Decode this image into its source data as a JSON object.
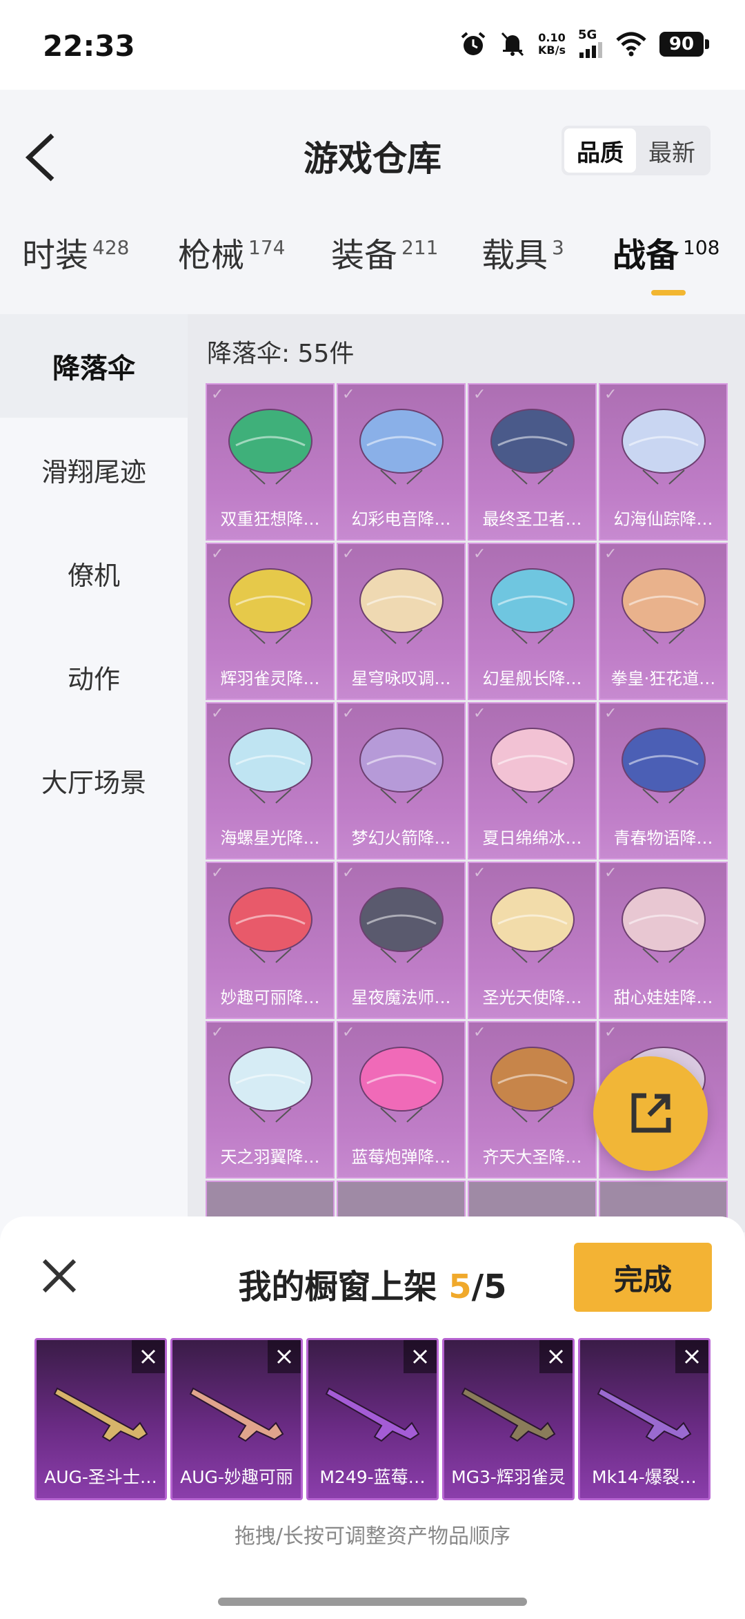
{
  "status": {
    "time": "22:33",
    "speed_top": "0.10",
    "speed_bottom": "KB/s",
    "network": "5G",
    "battery": "90"
  },
  "header": {
    "title": "游戏仓库",
    "sort": [
      "品质",
      "最新"
    ],
    "tabs": [
      {
        "label": "时装",
        "count": "428"
      },
      {
        "label": "枪械",
        "count": "174"
      },
      {
        "label": "装备",
        "count": "211"
      },
      {
        "label": "载具",
        "count": "3"
      },
      {
        "label": "战备",
        "count": "108"
      }
    ]
  },
  "sidebar": {
    "items": [
      "降落伞",
      "滑翔尾迹",
      "僚机",
      "动作",
      "大厅场景"
    ]
  },
  "grid": {
    "count_label": "降落伞: 55件",
    "items": [
      {
        "name": "双重狂想降…",
        "color": "#3fb07a"
      },
      {
        "name": "幻彩电音降…",
        "color": "#8ab0e8"
      },
      {
        "name": "最终圣卫者…",
        "color": "#4a5a8a"
      },
      {
        "name": "幻海仙踪降…",
        "color": "#c9d6f2"
      },
      {
        "name": "辉羽雀灵降…",
        "color": "#e6c94a"
      },
      {
        "name": "星穹咏叹调…",
        "color": "#efd9b2"
      },
      {
        "name": "幻星舰长降…",
        "color": "#6fc6e0"
      },
      {
        "name": "拳皇·狂花道…",
        "color": "#e9b28c"
      },
      {
        "name": "海螺星光降…",
        "color": "#bfe4f2"
      },
      {
        "name": "梦幻火箭降…",
        "color": "#b69ad8"
      },
      {
        "name": "夏日绵绵冰…",
        "color": "#f2c2d4"
      },
      {
        "name": "青春物语降…",
        "color": "#4b5fb5"
      },
      {
        "name": "妙趣可丽降…",
        "color": "#e85a6a"
      },
      {
        "name": "星夜魔法师…",
        "color": "#5a5a6e"
      },
      {
        "name": "圣光天使降…",
        "color": "#f2dcaa"
      },
      {
        "name": "甜心娃娃降…",
        "color": "#e8c7d2"
      },
      {
        "name": "天之羽翼降…",
        "color": "#d6ecf5"
      },
      {
        "name": "蓝莓炮弹降…",
        "color": "#f06ab8"
      },
      {
        "name": "齐天大圣降…",
        "color": "#c7854a"
      },
      {
        "name": "",
        "color": "#d9c9e0"
      }
    ]
  },
  "sheet": {
    "title_prefix": "我的橱窗上架 ",
    "title_current": "5",
    "title_suffix": "/5",
    "done": "完成",
    "items": [
      "AUG-圣斗士…",
      "AUG-妙趣可丽",
      "M249-蓝莓…",
      "MG3-辉羽雀灵",
      "Mk14-爆裂…"
    ],
    "hint": "拖拽/长按可调整资产物品顺序"
  }
}
